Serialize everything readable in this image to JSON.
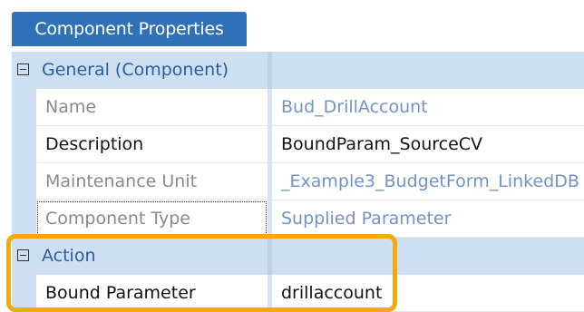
{
  "panel": {
    "title": "Component Properties"
  },
  "categories": [
    {
      "label": "General (Component)",
      "properties": [
        {
          "name": "Name",
          "value": "Bud_DrillAccount",
          "editable": false
        },
        {
          "name": "Description",
          "value": "BoundParam_SourceCV",
          "editable": true
        },
        {
          "name": "Maintenance Unit",
          "value": "_Example3_BudgetForm_LinkedDB",
          "editable": false
        },
        {
          "name": "Component Type",
          "value": "Supplied Parameter",
          "editable": false
        }
      ]
    },
    {
      "label": "Action",
      "properties": [
        {
          "name": "Bound Parameter",
          "value": "drillaccount",
          "editable": true
        }
      ]
    }
  ],
  "colors": {
    "title_bg": "#2e71b8",
    "category_bg": "#cfdff2",
    "highlight": "#f4a90f",
    "readonly_value": "#7393c4"
  },
  "icons": {
    "collapse": "minus-box-icon"
  }
}
